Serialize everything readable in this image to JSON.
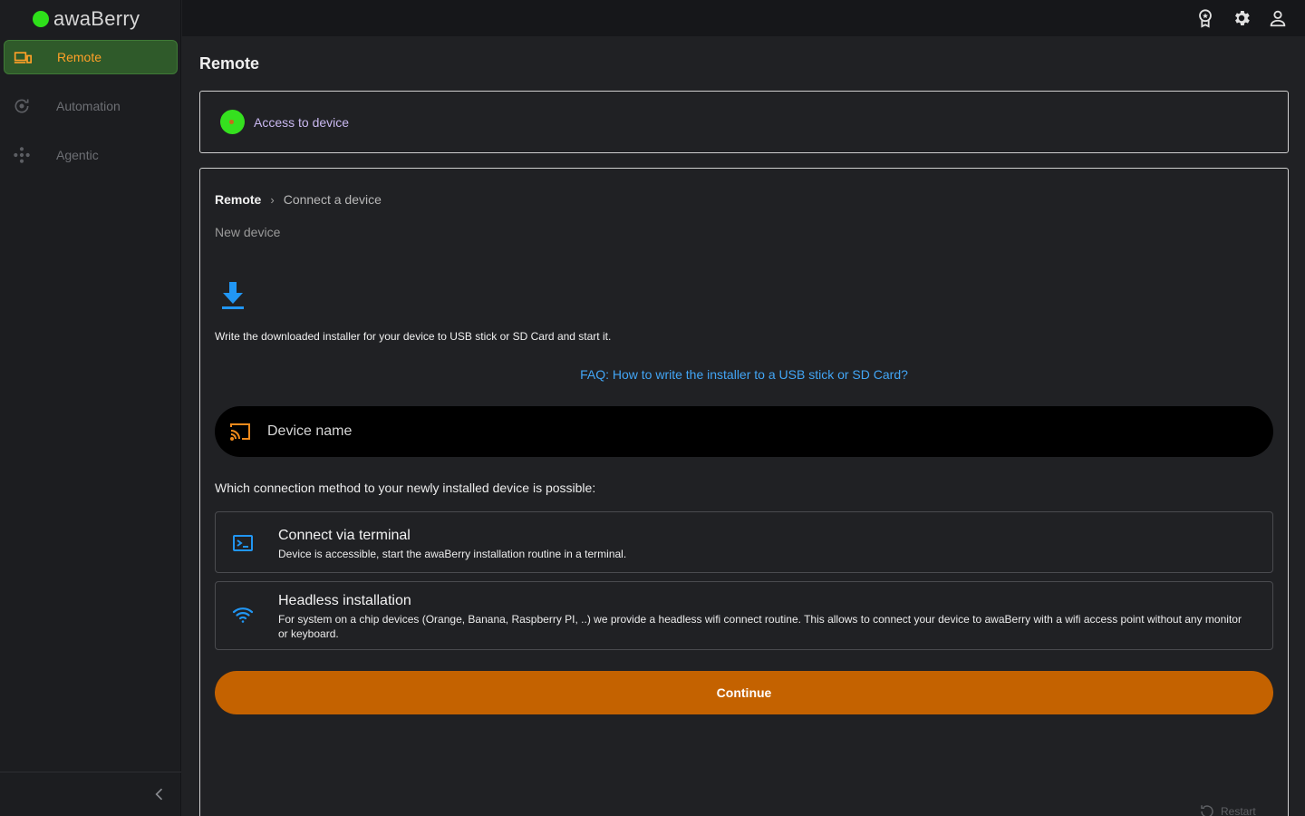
{
  "app": {
    "name": "awaBerry"
  },
  "colors": {
    "accent": "#ffa028",
    "brand_green": "#2ee01a",
    "primary_button": "#c46200",
    "link": "#42a5f5"
  },
  "sidebar": {
    "items": [
      {
        "label": "Remote",
        "icon": "devices-icon",
        "active": true
      },
      {
        "label": "Automation",
        "icon": "automation-icon",
        "active": false
      },
      {
        "label": "Agentic",
        "icon": "agentic-icon",
        "active": false
      }
    ]
  },
  "topbar": {
    "icons": [
      "award-icon",
      "settings-icon",
      "account-icon"
    ]
  },
  "page": {
    "title": "Remote"
  },
  "status": {
    "text": "Access to device"
  },
  "breadcrumb": {
    "root": "Remote",
    "separator": "›",
    "current": "Connect a device"
  },
  "wizard": {
    "subtitle": "New device",
    "instruction": "Write the downloaded installer for your device to USB stick or SD Card and start it.",
    "faq_link": "FAQ: How to write the installer to a USB stick or SD Card?",
    "device_name_placeholder": "Device name",
    "device_name_value": "",
    "question": "Which connection method to your newly installed device is possible:",
    "options": [
      {
        "title": "Connect via terminal",
        "description": "Device is accessible, start the awaBerry installation routine in a terminal.",
        "icon": "terminal-icon"
      },
      {
        "title": "Headless installation",
        "description": "For system on a chip devices (Orange, Banana, Raspberry PI, ..) we provide a headless wifi connect routine. This allows to connect your device to awaBerry with a wifi access point without any monitor or keyboard.",
        "icon": "wifi-icon"
      }
    ],
    "continue_label": "Continue",
    "restart_label": "Restart"
  }
}
